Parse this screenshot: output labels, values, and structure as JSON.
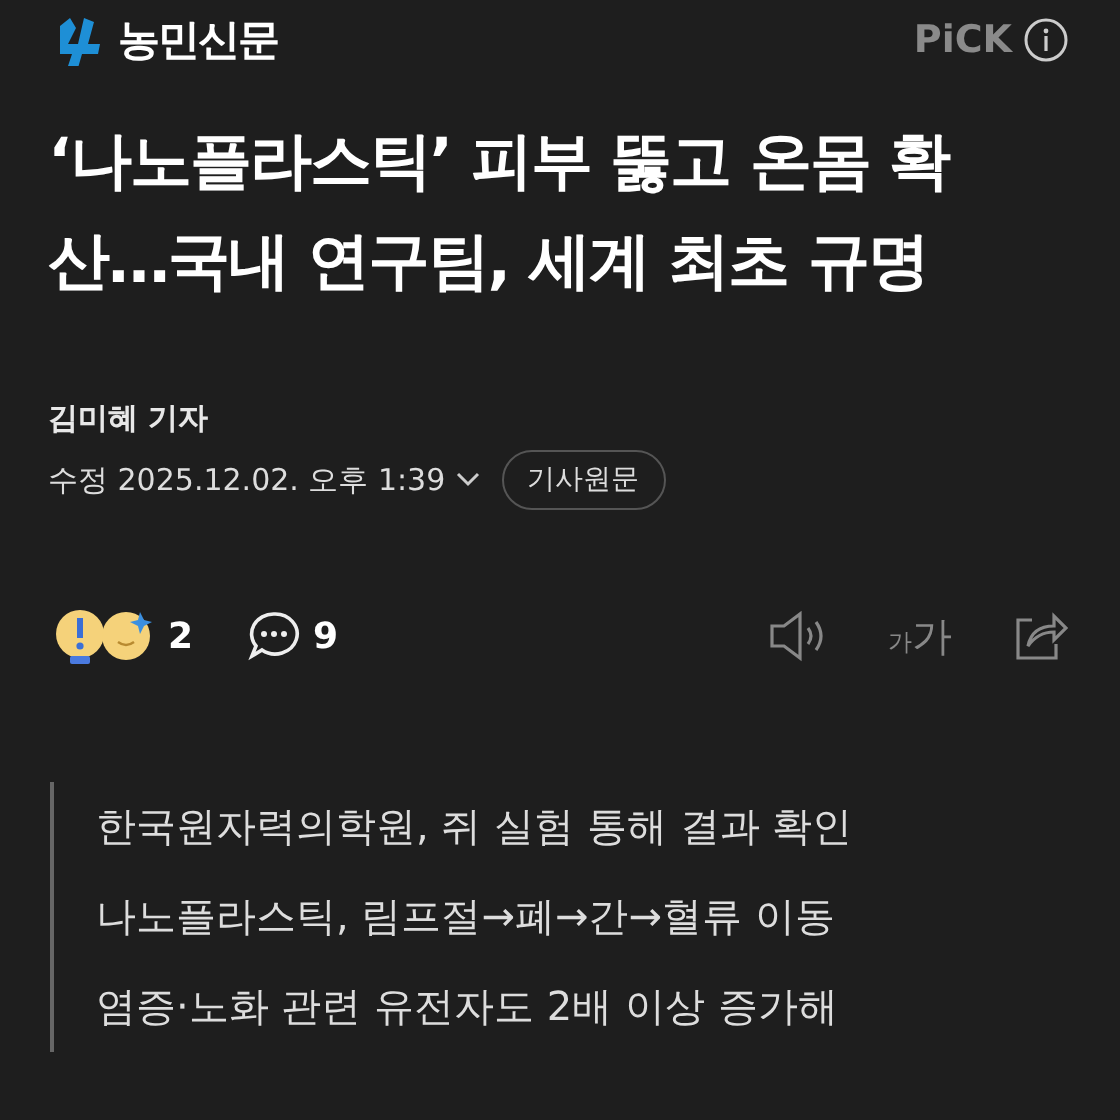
{
  "header": {
    "publisher": "농민신문",
    "pick": "PiCK"
  },
  "headline": "‘나노플라스틱’ 피부 뚫고 온몸 확산…국내 연구팀, 세계 최초 규명",
  "byline": {
    "author": "김미혜 기자",
    "date": "수정 2025.12.02. 오후 1:39",
    "original_button": "기사원문"
  },
  "actions": {
    "reactions_count": "2",
    "comments_count": "9",
    "font_small": "가",
    "font_large": "가"
  },
  "summary": [
    "한국원자력의학원, 쥐 실험 통해 결과 확인",
    "나노플라스틱, 림프절→폐→간→혈류 이동",
    "염증·노화 관련 유전자도 2배 이상 증가해"
  ]
}
